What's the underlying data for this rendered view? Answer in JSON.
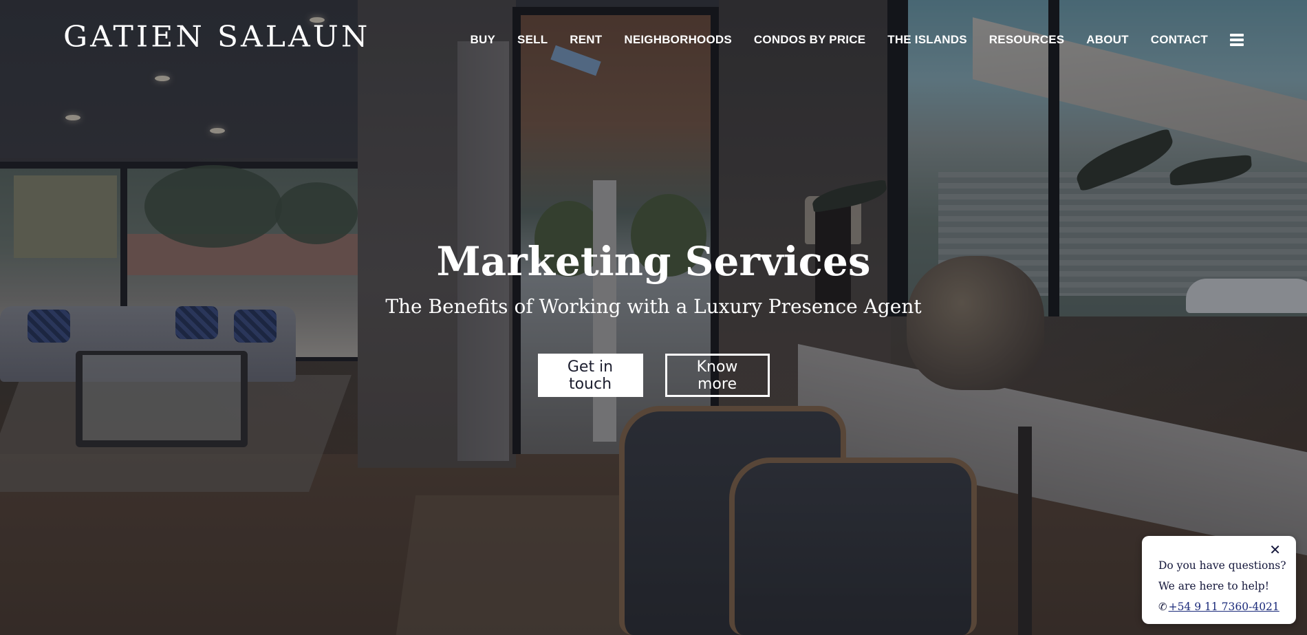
{
  "brand": {
    "logo_text": "GATIEN SALAUN"
  },
  "nav": {
    "items": [
      {
        "label": "BUY"
      },
      {
        "label": "SELL"
      },
      {
        "label": "RENT"
      },
      {
        "label": "NEIGHBORHOODS"
      },
      {
        "label": "CONDOS BY PRICE"
      },
      {
        "label": "THE ISLANDS"
      },
      {
        "label": "RESOURCES"
      },
      {
        "label": "ABOUT"
      },
      {
        "label": "CONTACT"
      }
    ],
    "menu_icon": "hamburger-menu-icon"
  },
  "hero": {
    "title": "Marketing Services",
    "subtitle": "The Benefits of Working with a Luxury Presence Agent",
    "primary_button": "Get in touch",
    "secondary_button": "Know more"
  },
  "chat": {
    "close_icon": "close-icon",
    "line1": "Do you have questions?",
    "line2": "We are here to help!",
    "phone_icon": "phone-icon",
    "phone": "+54 9 11 7360-4021"
  },
  "colors": {
    "text_on_hero": "#ffffff",
    "button_solid_bg": "#ffffff",
    "button_solid_text": "#1b1d2e",
    "chat_text": "#13163a",
    "chat_link": "#1a2a7a"
  }
}
